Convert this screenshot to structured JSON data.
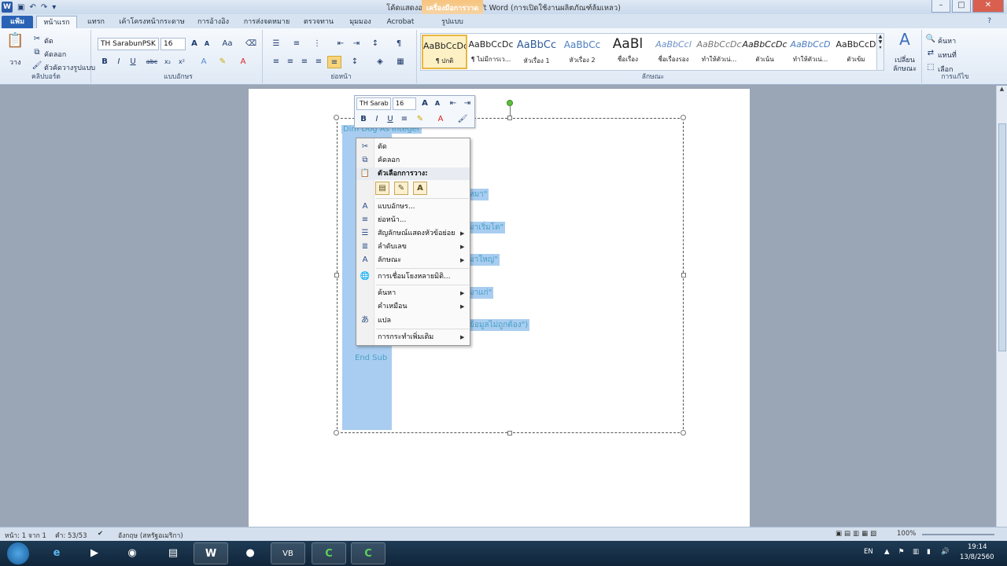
{
  "titlebar": {
    "title": "โค้ดแสดงอายุหมา - Microsoft Word (การเปิดใช้งานผลิตภัณฑ์ล้มเหลว)",
    "context_tool": "เครื่องมือการวาด",
    "min": "–",
    "max": "□",
    "close": "✕"
  },
  "tabs": {
    "file": "แฟ้ม",
    "items": [
      "หน้าแรก",
      "แทรก",
      "เค้าโครงหน้ากระดาษ",
      "การอ้างอิง",
      "การส่งจดหมาย",
      "ตรวจทาน",
      "มุมมอง",
      "Acrobat"
    ],
    "format": "รูปแบบ"
  },
  "ribbon": {
    "clipboard": {
      "paste": "วาง",
      "cut": "ตัด",
      "copy": "คัดลอก",
      "format_painter": "ตัวคัดวางรูปแบบ",
      "label": "คลิปบอร์ด"
    },
    "font": {
      "name": "TH SarabunPSK",
      "size": "16",
      "label": "แบบอักษร"
    },
    "paragraph": {
      "label": "ย่อหน้า"
    },
    "styles": {
      "label": "ลักษณะ",
      "items": [
        {
          "preview": "AaBbCcDc",
          "name": "¶ ปกติ"
        },
        {
          "preview": "AaBbCcDc",
          "name": "¶ ไม่มีการเว..."
        },
        {
          "preview": "AaBbCc",
          "name": "หัวเรื่อง 1"
        },
        {
          "preview": "AaBbCc",
          "name": "หัวเรื่อง 2"
        },
        {
          "preview": "AaBl",
          "name": "ชื่อเรื่อง"
        },
        {
          "preview": "AaBbCcl",
          "name": "ชื่อเรื่องรอง"
        },
        {
          "preview": "AaBbCcDc",
          "name": "ทำให้ตัวเน่..."
        },
        {
          "preview": "AaBbCcDc",
          "name": "ตัวเน้น"
        },
        {
          "preview": "AaBbCcD",
          "name": "ทำให้ตัวเน่..."
        },
        {
          "preview": "AaBbCcD",
          "name": "ตัวเข้ม"
        }
      ],
      "change": "เปลี่ยน\nลักษณะ"
    },
    "editing": {
      "find": "ค้นหา",
      "replace": "แทนที่",
      "select": "เลือก",
      "label": "การแก้ไข"
    }
  },
  "mini_toolbar": {
    "font": "TH Sarab",
    "size": "16"
  },
  "document": {
    "lines": [
      "Dim Dog As Integer",
      "หมา\"",
      "มาเริ่มโต\"",
      "มาใหญ่\"",
      "มาแก่\"",
      "ข้อมูลไม่ถูกต้อง\")",
      "End Sub"
    ]
  },
  "context_menu": {
    "items": [
      {
        "icon": "scissors-icon",
        "label": "ตัด"
      },
      {
        "icon": "copy-icon",
        "label": "คัดลอก"
      },
      {
        "icon": "paste-icon",
        "label": "ตัวเลือกการวาง:"
      },
      {
        "icon": "font-icon",
        "label": "แบบอักษร..."
      },
      {
        "icon": "paragraph-icon",
        "label": "ย่อหน้า..."
      },
      {
        "icon": "bullets-icon",
        "label": "สัญลักษณ์แสดงหัวข้อย่อย"
      },
      {
        "icon": "numbering-icon",
        "label": "ลำดับเลข"
      },
      {
        "icon": "styles-icon",
        "label": "ลักษณะ"
      },
      {
        "icon": "hyperlink-icon",
        "label": "การเชื่อมโยงหลายมิติ..."
      },
      {
        "icon": "",
        "label": "ค้นหา"
      },
      {
        "icon": "",
        "label": "คำเหมือน"
      },
      {
        "icon": "translate-icon",
        "label": "แปล"
      },
      {
        "icon": "",
        "label": "การกระทำเพิ่มเติม"
      }
    ]
  },
  "statusbar": {
    "page": "หน้า: 1 จาก 1",
    "words": "คำ: 53/53",
    "language": "อังกฤษ (สหรัฐอเมริกา)",
    "zoom": "100%"
  },
  "taskbar": {
    "lang": "EN",
    "time": "19:14",
    "date": "13/8/2560"
  }
}
